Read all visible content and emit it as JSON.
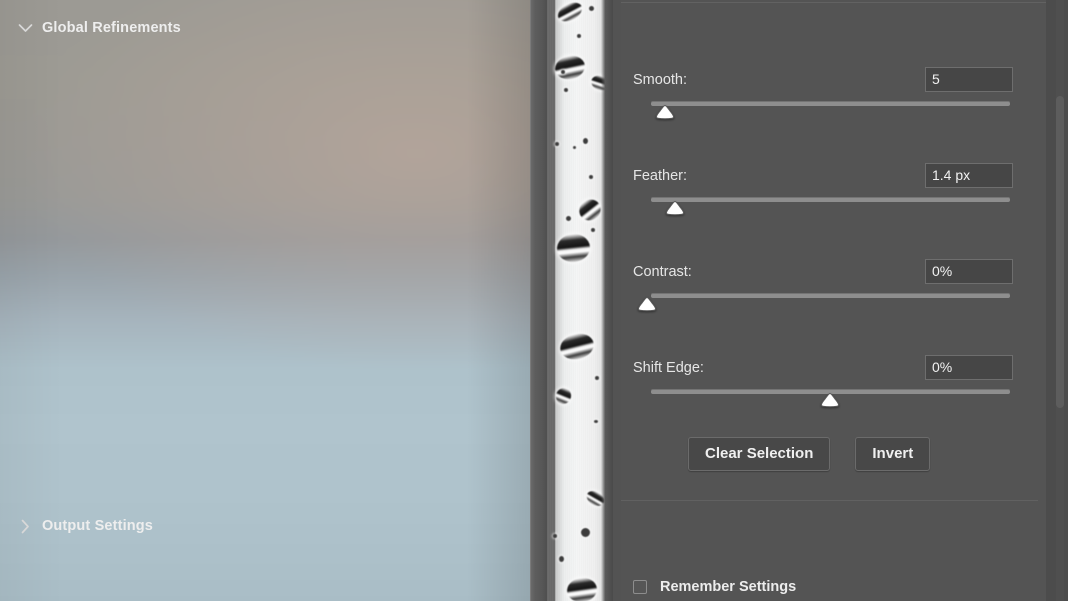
{
  "panel": {
    "sections": [
      {
        "id": "global-refinements",
        "title": "Global Refinements",
        "expanded_icon": "chevron-down-icon",
        "expanded": true
      },
      {
        "id": "output-settings",
        "title": "Output Settings",
        "expanded_icon": "chevron-right-icon",
        "expanded": false
      }
    ],
    "sliders": [
      {
        "id": "smooth",
        "label": "Smooth:",
        "value": "5",
        "thumb_pct": 4.0
      },
      {
        "id": "feather",
        "label": "Feather:",
        "value": "1.4 px",
        "thumb_pct": 6.5
      },
      {
        "id": "contrast",
        "label": "Contrast:",
        "value": "0%",
        "thumb_pct": 0.0
      },
      {
        "id": "shift-edge",
        "label": "Shift Edge:",
        "value": "0%",
        "thumb_pct": 50.0
      }
    ],
    "buttons": [
      {
        "id": "clear-selection",
        "label": "Clear Selection"
      },
      {
        "id": "invert",
        "label": "Invert"
      }
    ],
    "checkbox": {
      "id": "remember-settings",
      "label": "Remember Settings",
      "checked": false
    }
  },
  "colors": {
    "panel_bg": "#545454",
    "panel_rail": "#4c4c4c",
    "field_bg": "#464646",
    "field_border": "#6e6e6e",
    "track": "#8e8e8e",
    "thumb": "#ffffff",
    "text": "#ececec",
    "divider": "#616161",
    "button_bg": "#484848"
  },
  "canvas": {
    "name": "document-preview",
    "description": "blurred sky gradient with masked vertical strip of water droplets"
  }
}
